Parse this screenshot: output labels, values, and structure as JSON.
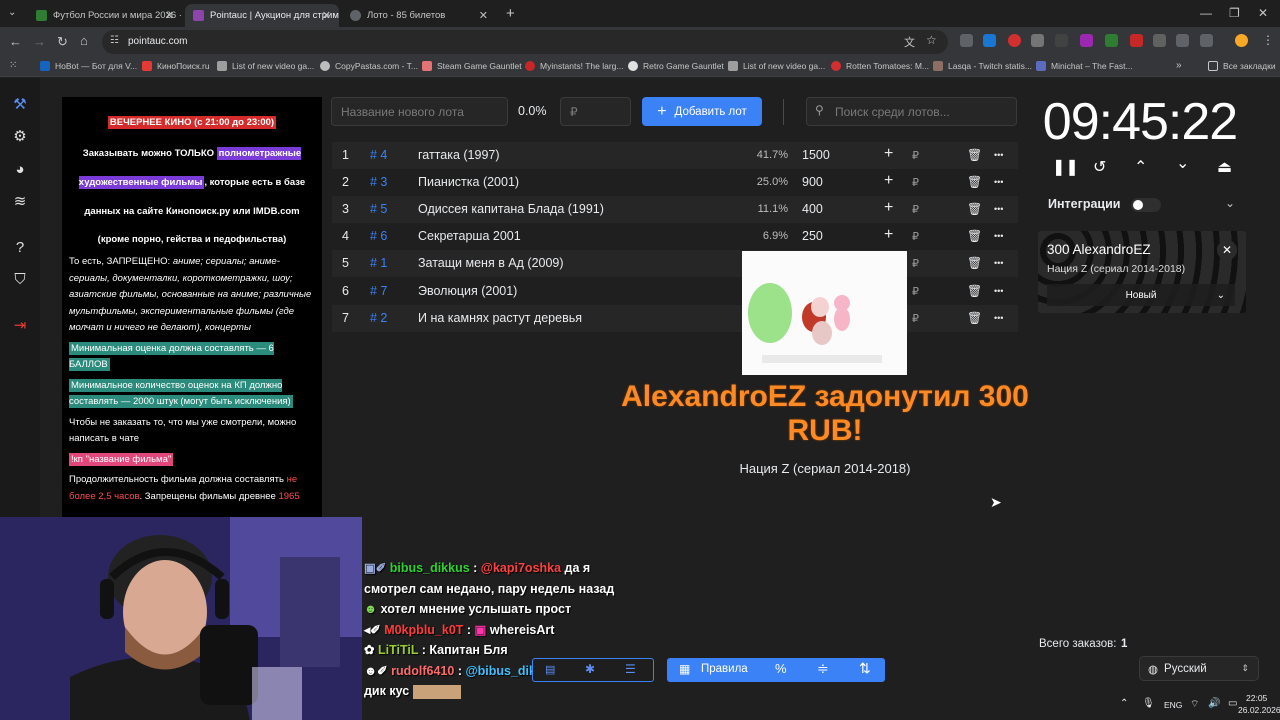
{
  "browser": {
    "tabs": [
      {
        "title": "Футбол России и мира 2026 ·",
        "active": false,
        "color": "#2e7d32"
      },
      {
        "title": "Pointauc | Аукцион для стрим",
        "active": true,
        "color": "#8e44ad"
      },
      {
        "title": "Лото - 85 билетов",
        "active": false,
        "color": "#5f6368"
      }
    ],
    "url": "pointauc.com",
    "bookmarks": [
      "HoBot — Бот для V...",
      "КиноПоиск.ru",
      "List of new video ga...",
      "CopyPastas.com - T...",
      "Steam Game Gauntlet",
      "Myinstants! The larg...",
      "Retro Game Gauntlet",
      "List of new video ga...",
      "Rotten Tomatoes: M...",
      "Lasqa - Twitch statis...",
      "Minichat – The Fast..."
    ],
    "all_bookmarks": "Все закладки"
  },
  "rules": {
    "title": "ВЕЧЕРНЕЕ КИНО (с 21:00 до 23:00)",
    "line1_a": "Заказывать можно ТОЛЬКО ",
    "line1_hl": "полнометражные художественные фильмы",
    "line1_b": ", которые есть в базе данных на сайте Кинопоиск.ру или IMDB.com",
    "line2": "(кроме порно, гейства и педофильства)",
    "forbidden_lead": "То есть, ЗАПРЕЩЕНО: ",
    "forbidden": "аниме; сериалы; аниме-сериалы, документалки, короткометражки, шоу; азиатские фильмы, основанные на аниме; различные мультфильмы, экспериментальные фильмы (где молчат и ничего не делают), концерты",
    "min_rating": "Минимальная оценка должна составлять — 6 БАЛЛОВ",
    "min_votes": "Минимальное количество оценок на КП должно составлять — 2000 штук (могут быть исключения)",
    "dont_order": "Чтобы не заказать то, что мы уже смотрели, можно написать в чате",
    "kp_cmd": "!кп \"название фильма\"",
    "duration_a": "Продолжительность фильма должна составлять ",
    "duration_b": "не более 2,5 часов",
    "duration_c": ". Запрещены фильмы древнее ",
    "duration_d": "1965"
  },
  "controls": {
    "new_lot_placeholder": "Название нового лота",
    "percent": "0.0%",
    "rub_placeholder": "₽",
    "add_lot": "Добавить лот",
    "search_placeholder": "Поиск среди лотов..."
  },
  "lots": [
    {
      "num": "1",
      "id": "# 4",
      "name": "гаттака (1997)",
      "pct": "41.7%",
      "sum": "1500"
    },
    {
      "num": "2",
      "id": "# 3",
      "name": "Пианистка (2001)",
      "pct": "25.0%",
      "sum": "900"
    },
    {
      "num": "3",
      "id": "# 5",
      "name": "Одиссея капитана Блада (1991)",
      "pct": "11.1%",
      "sum": "400"
    },
    {
      "num": "4",
      "id": "# 6",
      "name": "Секретарша 2001",
      "pct": "6.9%",
      "sum": "250"
    },
    {
      "num": "5",
      "id": "# 1",
      "name": "Затащи меня в Ад (2009)",
      "pct": "",
      "sum": ""
    },
    {
      "num": "6",
      "id": "# 7",
      "name": "Эволюция (2001)",
      "pct": "",
      "sum": ""
    },
    {
      "num": "7",
      "id": "# 2",
      "name": "И на камнях растут деревья",
      "pct": "",
      "sum": ""
    }
  ],
  "lot_currency": "₽",
  "donation": {
    "message": "AlexandroEZ задонутил 300 RUB!",
    "text": "Нация Z (сериал 2014-2018)"
  },
  "timer": "09:45:22",
  "integrations": "Интеграции",
  "card": {
    "title": "300 AlexandroEZ",
    "subtitle": "Нация Z (сериал 2014-2018)",
    "status": "Новый"
  },
  "chat": [
    {
      "user": "bibus_dikkus",
      "mention": "@kapi7oshka",
      "text": " да я смотрел сам недано, пару недель назад ",
      "tail": " хотел мнение услышать прост"
    },
    {
      "user": "M0kpblu_k0T",
      "text": " whereisArt"
    },
    {
      "user": "LiTiTiL",
      "text": " Капитан Бля"
    },
    {
      "user": "rudolf6410",
      "mention": "@bibus_dikkus",
      "text": " биб ус дик кус"
    }
  ],
  "bottom": {
    "rules_label": "Правила",
    "orders_label": "Всего заказов:",
    "orders_count": "1",
    "language": "Русский"
  },
  "tray": {
    "lang": "ENG",
    "time": "22:05",
    "date": "26.02.2026"
  }
}
